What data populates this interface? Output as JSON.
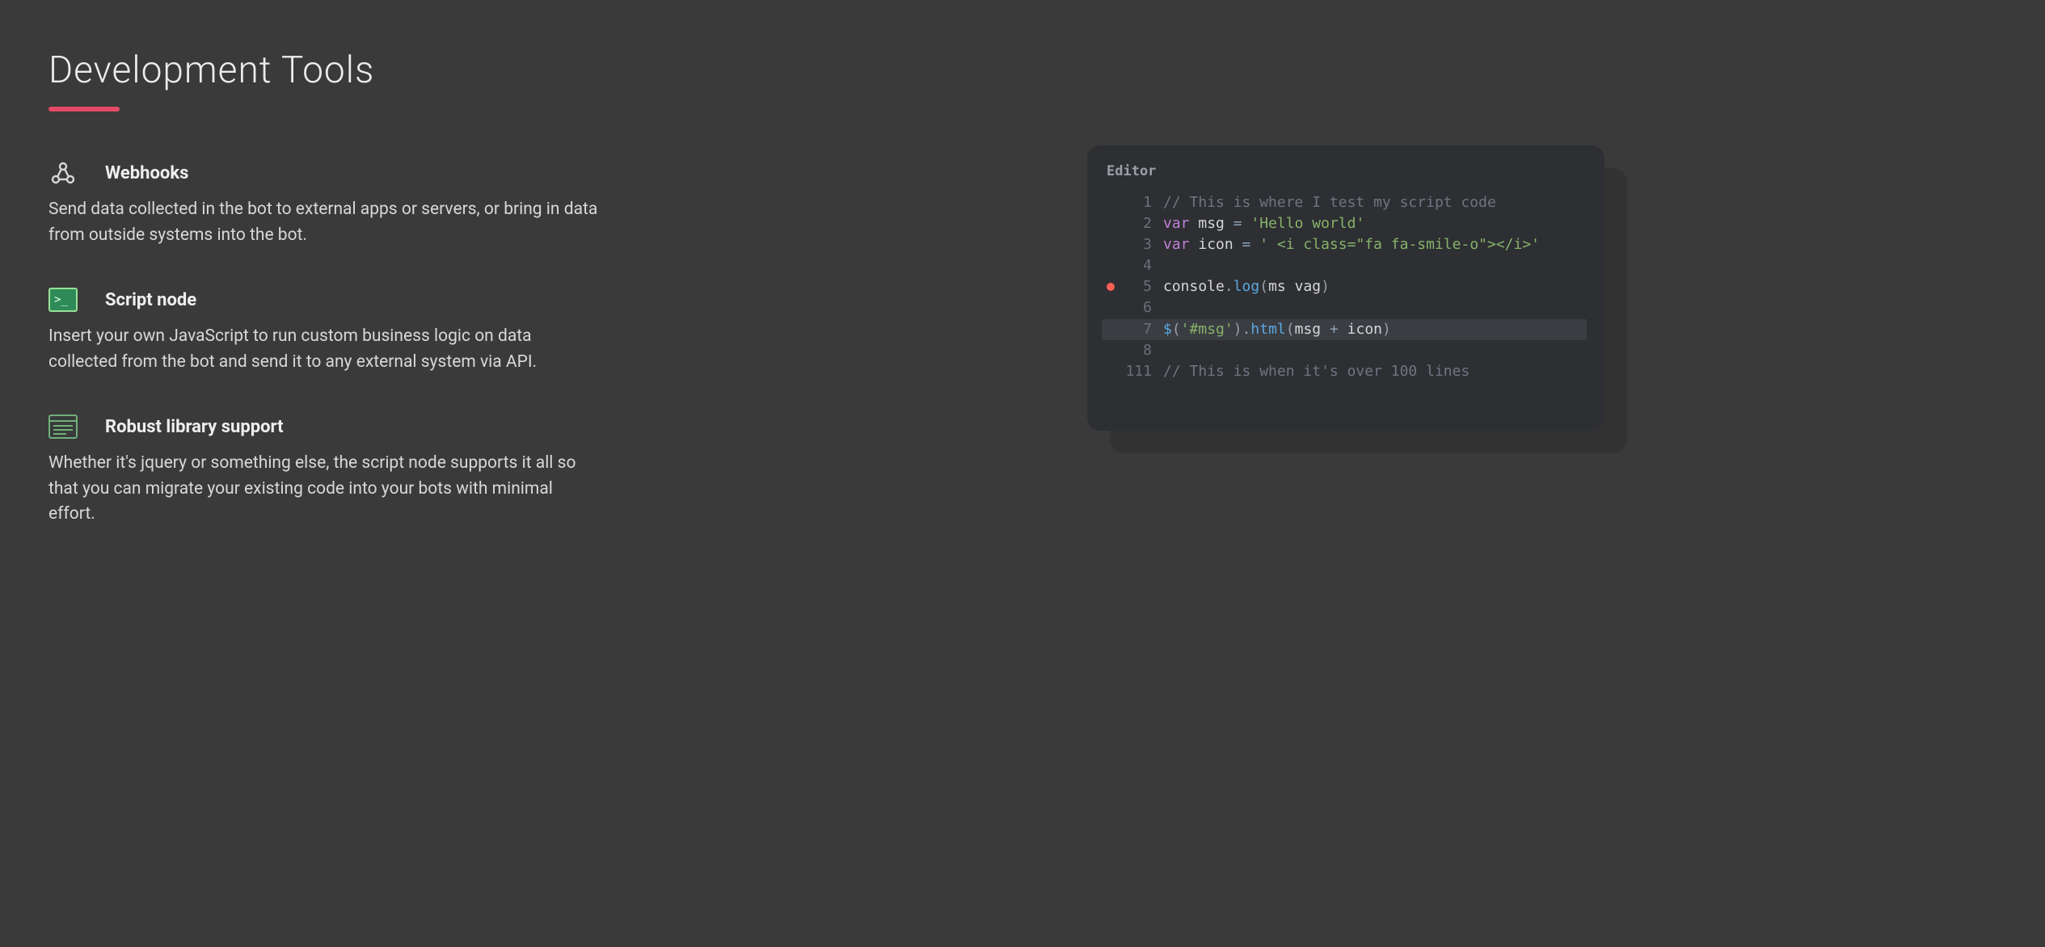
{
  "heading": "Development Tools",
  "features": [
    {
      "title": "Webhooks",
      "desc": "Send data collected in the bot to external apps or servers, or bring in data from outside systems into the bot."
    },
    {
      "title": "Script node",
      "desc": "Insert your own JavaScript to run custom business logic on data collected from the bot and send it to any external system via API."
    },
    {
      "title": "Robust library support",
      "desc": "Whether it's jquery or something else, the script node supports it all so that you can migrate your existing code into your bots with minimal effort."
    }
  ],
  "editor": {
    "label": "Editor",
    "lines": [
      {
        "n": "1",
        "bp": false,
        "hl": false,
        "tokens": [
          [
            "comment",
            "// This is where I test my script code"
          ]
        ]
      },
      {
        "n": "2",
        "bp": false,
        "hl": false,
        "tokens": [
          [
            "kw",
            "var "
          ],
          [
            "ident",
            "msg "
          ],
          [
            "op",
            "= "
          ],
          [
            "str",
            "'Hello world'"
          ]
        ]
      },
      {
        "n": "3",
        "bp": false,
        "hl": false,
        "tokens": [
          [
            "kw",
            "var "
          ],
          [
            "ident",
            "icon "
          ],
          [
            "op",
            "= "
          ],
          [
            "str",
            "' <i class=\"fa fa-smile-o\"></i>'"
          ]
        ]
      },
      {
        "n": "4",
        "bp": false,
        "hl": false,
        "tokens": []
      },
      {
        "n": "5",
        "bp": true,
        "hl": false,
        "tokens": [
          [
            "ident",
            "console"
          ],
          [
            "punc",
            "."
          ],
          [
            "func",
            "log"
          ],
          [
            "punc",
            "("
          ],
          [
            "ident",
            "ms vag"
          ],
          [
            "punc",
            ")"
          ]
        ]
      },
      {
        "n": "6",
        "bp": false,
        "hl": false,
        "tokens": []
      },
      {
        "n": "7",
        "bp": false,
        "hl": true,
        "tokens": [
          [
            "func",
            "$"
          ],
          [
            "punc",
            "("
          ],
          [
            "str",
            "'#msg'"
          ],
          [
            "punc",
            ")"
          ],
          [
            "punc",
            "."
          ],
          [
            "func",
            "html"
          ],
          [
            "punc",
            "("
          ],
          [
            "ident",
            "msg "
          ],
          [
            "op",
            "+ "
          ],
          [
            "ident",
            "icon"
          ],
          [
            "punc",
            ")"
          ]
        ]
      },
      {
        "n": "8",
        "bp": false,
        "hl": false,
        "tokens": []
      },
      {
        "n": "111",
        "bp": false,
        "hl": false,
        "tokens": [
          [
            "comment",
            "// This is when it's over 100 lines"
          ]
        ]
      }
    ]
  }
}
